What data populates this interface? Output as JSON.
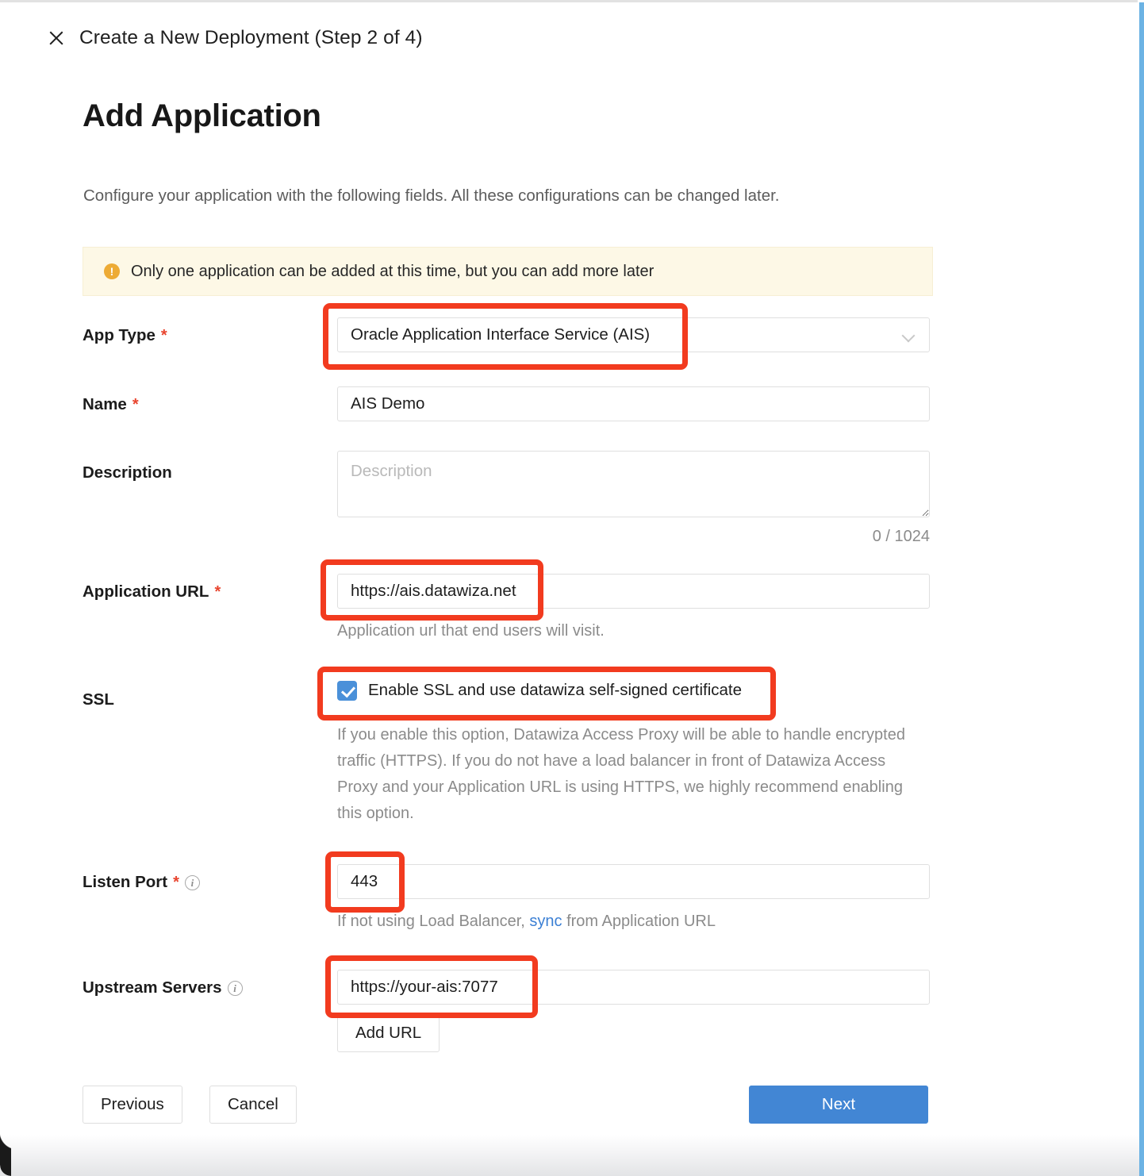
{
  "dialog": {
    "close_icon": "close-icon",
    "step_title": "Create a New Deployment (Step 2 of 4)",
    "title": "Add Application",
    "subtitle": "Configure your application with the following fields. All these configurations can be changed later."
  },
  "alert": {
    "icon": "warning-circle-icon",
    "text": "Only one application can be added at this time, but you can add more later",
    "background_color": "#fdf8e6",
    "icon_color": "#edab35"
  },
  "form": {
    "app_type": {
      "label": "App Type",
      "required_marker": "*",
      "value": "Oracle Application Interface Service (AIS)",
      "options": [
        "Oracle Application Interface Service (AIS)"
      ],
      "chevron_icon": "chevron-down-icon"
    },
    "name": {
      "label": "Name",
      "required_marker": "*",
      "value": "AIS Demo",
      "placeholder": "Name"
    },
    "description": {
      "label": "Description",
      "value": "",
      "placeholder": "Description",
      "counter": "0 / 1024"
    },
    "application_url": {
      "label": "Application URL",
      "required_marker": "*",
      "value": "https://ais.datawiza.net",
      "placeholder": "Application URL",
      "hint": "Application url that end users will visit."
    },
    "ssl": {
      "label": "SSL",
      "checkbox_label": "Enable SSL and use datawiza self-signed certificate",
      "checked": true,
      "checkbox_color": "#4a90d9",
      "hint": "If you enable this option, Datawiza Access Proxy will be able to handle encrypted traffic (HTTPS). If you do not have a load balancer in front of Datawiza Access Proxy and your Application URL is using HTTPS, we highly recommend enabling this option."
    },
    "listen_port": {
      "label": "Listen Port",
      "required_marker": "*",
      "info_icon": "info-circle-icon",
      "value": "443",
      "placeholder": "Listen Port",
      "hint_before": "If not using Load Balancer, ",
      "hint_link": "sync",
      "hint_after": " from Application URL"
    },
    "upstream_servers": {
      "label": "Upstream Servers",
      "info_icon": "info-circle-icon",
      "value": "https://your-ais:7077",
      "placeholder": "Upstream Server URL",
      "add_button": "Add URL"
    }
  },
  "footer": {
    "previous": "Previous",
    "cancel": "Cancel",
    "next": "Next",
    "primary_color": "#4286d4"
  },
  "annotations": {
    "color": "#f23b1f",
    "boxes": [
      "app-type",
      "application-url",
      "ssl-checkbox",
      "listen-port",
      "upstream-server"
    ]
  }
}
